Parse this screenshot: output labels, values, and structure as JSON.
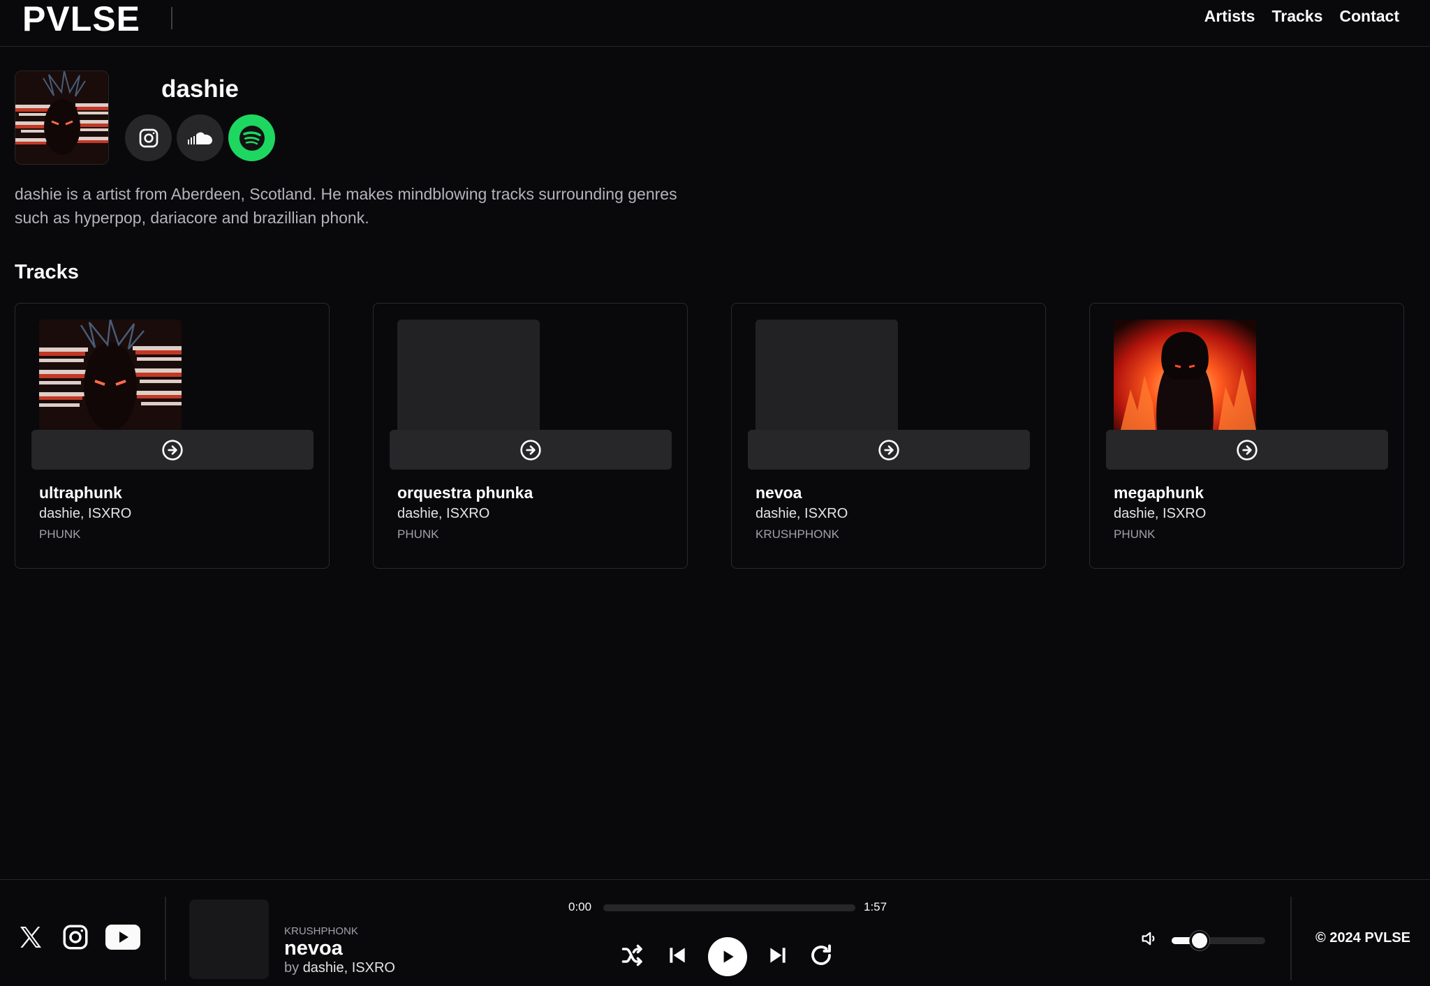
{
  "header": {
    "logo": "PVLSE",
    "nav": [
      "Artists",
      "Tracks",
      "Contact"
    ]
  },
  "artist": {
    "name": "dashie",
    "bio": "dashie is a artist from Aberdeen, Scotland. He makes mindblowing tracks surrounding genres such as hyperpop, dariacore and brazillian phonk.",
    "socials": [
      "instagram-icon",
      "soundcloud-icon",
      "spotify-icon"
    ]
  },
  "tracks_section": {
    "title": "Tracks",
    "items": [
      {
        "title": "ultraphunk",
        "artists": "dashie, ISXRO",
        "genre": "PHUNK",
        "cover": "red-white glitch art"
      },
      {
        "title": "orquestra phunka",
        "artists": "dashie, ISXRO",
        "genre": "PHUNK",
        "cover": "placeholder"
      },
      {
        "title": "nevoa",
        "artists": "dashie, ISXRO",
        "genre": "KRUSHPHONK",
        "cover": "placeholder"
      },
      {
        "title": "megaphunk",
        "artists": "dashie, ISXRO",
        "genre": "PHUNK",
        "cover": "fire anime art"
      }
    ]
  },
  "player": {
    "genre": "KRUSHPHONK",
    "title": "nevoa",
    "by_prefix": "by",
    "artists": "dashie, ISXRO",
    "current_time": "0:00",
    "duration": "1:57",
    "progress": 0,
    "volume": 0.3,
    "footer_socials": [
      "x-icon",
      "instagram-icon",
      "youtube-icon"
    ],
    "copyright": "© 2024 PVLSE"
  },
  "colors": {
    "background": "#09090b",
    "card_border": "#2a2a2e",
    "surface": "#27272a",
    "spotify": "#1ed760"
  }
}
